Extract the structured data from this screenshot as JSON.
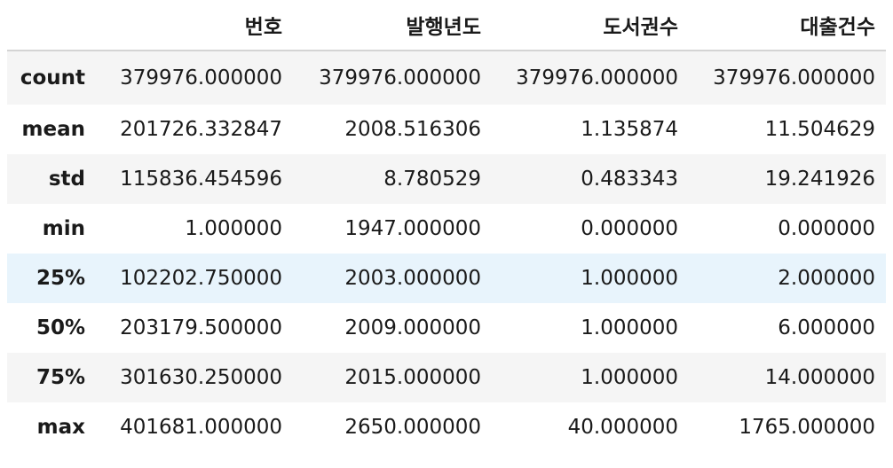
{
  "table": {
    "columns": [
      "번호",
      "발행년도",
      "도서권수",
      "대출건수"
    ],
    "highlighted_row": "25%",
    "rows": [
      {
        "label": "count",
        "values": [
          "379976.000000",
          "379976.000000",
          "379976.000000",
          "379976.000000"
        ]
      },
      {
        "label": "mean",
        "values": [
          "201726.332847",
          "2008.516306",
          "1.135874",
          "11.504629"
        ]
      },
      {
        "label": "std",
        "values": [
          "115836.454596",
          "8.780529",
          "0.483343",
          "19.241926"
        ]
      },
      {
        "label": "min",
        "values": [
          "1.000000",
          "1947.000000",
          "0.000000",
          "0.000000"
        ]
      },
      {
        "label": "25%",
        "values": [
          "102202.750000",
          "2003.000000",
          "1.000000",
          "2.000000"
        ]
      },
      {
        "label": "50%",
        "values": [
          "203179.500000",
          "2009.000000",
          "1.000000",
          "6.000000"
        ]
      },
      {
        "label": "75%",
        "values": [
          "301630.250000",
          "2015.000000",
          "1.000000",
          "14.000000"
        ]
      },
      {
        "label": "max",
        "values": [
          "401681.000000",
          "2650.000000",
          "40.000000",
          "1765.000000"
        ]
      }
    ]
  }
}
